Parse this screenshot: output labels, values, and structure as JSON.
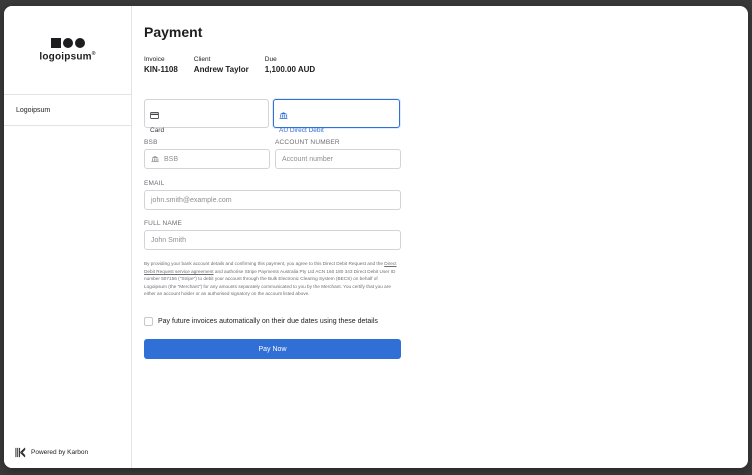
{
  "brand": {
    "logo_text": "logoipsum",
    "logo_mark": "®"
  },
  "sidebar": {
    "items": [
      {
        "label": "Logoipsum"
      }
    ],
    "powered_by": "Powered by Karbon"
  },
  "page": {
    "title": "Payment"
  },
  "invoice": {
    "invoice_label": "Invoice",
    "invoice_value": "KIN-1108",
    "client_label": "Client",
    "client_value": "Andrew Taylor",
    "due_label": "Due",
    "due_value": "1,100.00 AUD"
  },
  "tabs": [
    {
      "label": "Card",
      "icon": "card-icon",
      "active": false
    },
    {
      "label": "AU Direct Debit",
      "icon": "bank-icon",
      "active": true
    }
  ],
  "form": {
    "bsb_label": "BSB",
    "bsb_placeholder": "BSB",
    "account_label": "ACCOUNT NUMBER",
    "account_placeholder": "Account number",
    "email_label": "EMAIL",
    "email_placeholder": "john.smith@example.com",
    "name_label": "FULL NAME",
    "name_placeholder": "John Smith"
  },
  "consent": {
    "part1": "By providing your bank account details and confirming this payment, you agree to this Direct Debit Request and the ",
    "link": "Direct Debit Request service agreement",
    "part2": " and authorise Stripe Payments Australia Pty Ltd ACN 160 180 343 Direct Debit User ID number 507156 (\"Stripe\") to debit your account through the Bulk Electronic Clearing System (BECS) on behalf of Logoipsum (the \"Merchant\") for any amounts separately communicated to you by the Merchant. You certify that you are either an account holder or an authorised signatory on the account listed above."
  },
  "checkbox": {
    "label": "Pay future invoices automatically on their due dates using these details",
    "checked": false
  },
  "actions": {
    "pay_label": "Pay Now"
  },
  "colors": {
    "accent": "#2f6fd6",
    "text": "#1d1d1f",
    "muted": "#6e6e73",
    "border": "#d4d4d8"
  }
}
